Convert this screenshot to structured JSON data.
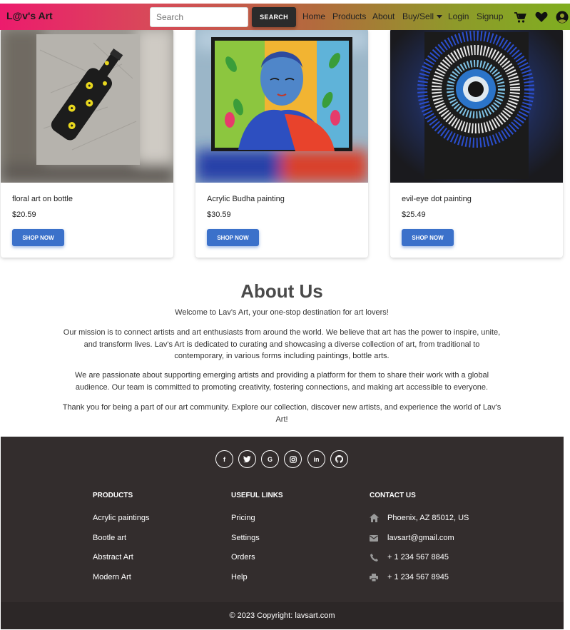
{
  "navbar": {
    "brand": "L@v's Art",
    "search_placeholder": "Search",
    "search_button": "SEARCH",
    "links": {
      "home": "Home",
      "products": "Products",
      "about": "About",
      "buysell": "Buy/Sell",
      "login": "Login",
      "signup": "Signup"
    },
    "icons": [
      "cart-icon",
      "heart-icon",
      "user-icon"
    ]
  },
  "products": [
    {
      "title": "floral art on bottle",
      "price": "$20.59",
      "button": "SHOP NOW"
    },
    {
      "title": "Acrylic Budha painting",
      "price": "$30.59",
      "button": "SHOP NOW"
    },
    {
      "title": "evil-eye dot painting",
      "price": "$25.49",
      "button": "SHOP NOW"
    }
  ],
  "about": {
    "title": "About Us",
    "welcome": "Welcome to Lav's Art, your one-stop destination for art lovers!",
    "mission": "Our mission is to connect artists and art enthusiasts from around the world. We believe that art has the power to inspire, unite, and transform lives. Lav's Art is dedicated to curating and showcasing a diverse collection of art, from traditional to contemporary, in various forms including paintings, bottle arts.",
    "passion": "We are passionate about supporting emerging artists and providing a platform for them to share their work with a global audience. Our team is committed to promoting creativity, fostering connections, and making art accessible to everyone.",
    "thanks": "Thank you for being a part of our art community. Explore our collection, discover new artists, and experience the world of Lav's Art!"
  },
  "footer": {
    "social": [
      "facebook-icon",
      "twitter-icon",
      "google-icon",
      "instagram-icon",
      "linkedin-icon",
      "github-icon"
    ],
    "products": {
      "heading": "PRODUCTS",
      "items": [
        "Acrylic paintings",
        "Bootle art",
        "Abstract Art",
        "Modern Art"
      ]
    },
    "links": {
      "heading": "USEFUL LINKS",
      "items": [
        "Pricing",
        "Settings",
        "Orders",
        "Help"
      ]
    },
    "contact": {
      "heading": "CONTACT US",
      "address": "Phoenix, AZ 85012, US",
      "email": "lavsart@gmail.com",
      "phone": "+ 1 234 567 8845",
      "fax": "+ 1 234 567 8945"
    },
    "copyright": "© 2023 Copyright: lavsart.com"
  }
}
